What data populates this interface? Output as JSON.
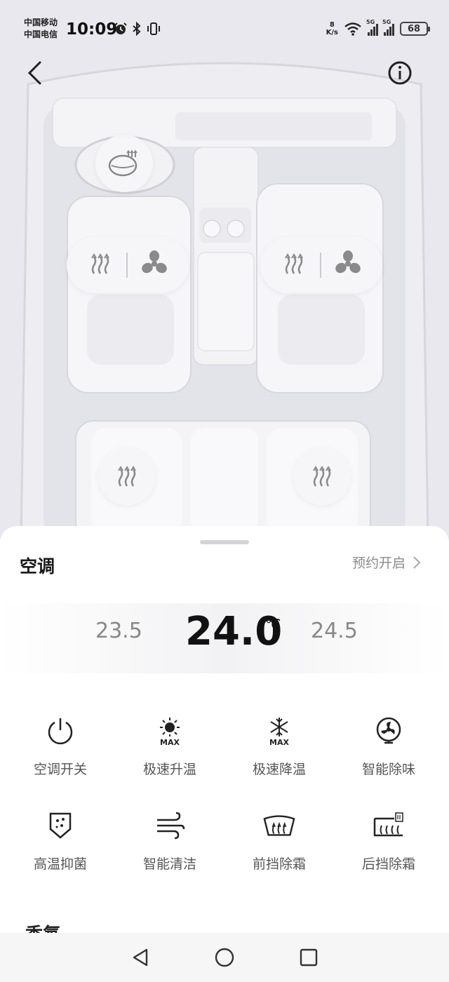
{
  "status_bar": {
    "carrier_1": "中国移动",
    "carrier_2": "中国电信",
    "time": "10:09",
    "net_speed_value": "8",
    "net_speed_unit": "K/s",
    "signal_1_label": "5G",
    "signal_2_label": "5G",
    "battery": "68"
  },
  "header": {
    "back_icon": "chevron-left-icon",
    "info_icon": "info-circle-icon"
  },
  "car_controls": {
    "steering_heat_icon": "steering-wheel-heat-icon",
    "driver_seat": {
      "heat_icon": "seat-heat-icon",
      "vent_icon": "seat-fan-icon"
    },
    "passenger_seat": {
      "heat_icon": "seat-heat-icon",
      "vent_icon": "seat-fan-icon"
    },
    "rear_left_heat_icon": "seat-heat-icon",
    "rear_right_heat_icon": "seat-heat-icon"
  },
  "ac": {
    "title": "空调",
    "schedule_label": "预约开启",
    "temp_lower": "23.5",
    "temp_current": "24.0",
    "temp_unit": "℃",
    "temp_higher": "24.5"
  },
  "functions": [
    {
      "label": "空调开关",
      "icon": "power-icon"
    },
    {
      "label": "极速升温",
      "icon": "sun-max-icon"
    },
    {
      "label": "极速降温",
      "icon": "snowflake-max-icon"
    },
    {
      "label": "智能除味",
      "icon": "fan-icon"
    },
    {
      "label": "高温抑菌",
      "icon": "sterilize-icon"
    },
    {
      "label": "智能清洁",
      "icon": "wind-icon"
    },
    {
      "label": "前挡除霜",
      "icon": "front-defrost-icon"
    },
    {
      "label": "后挡除霜",
      "icon": "rear-defrost-icon"
    }
  ],
  "fragrance_title": "香氛",
  "nav": {
    "back": "triangle-back-icon",
    "home": "circle-home-icon",
    "recent": "square-recent-icon"
  }
}
